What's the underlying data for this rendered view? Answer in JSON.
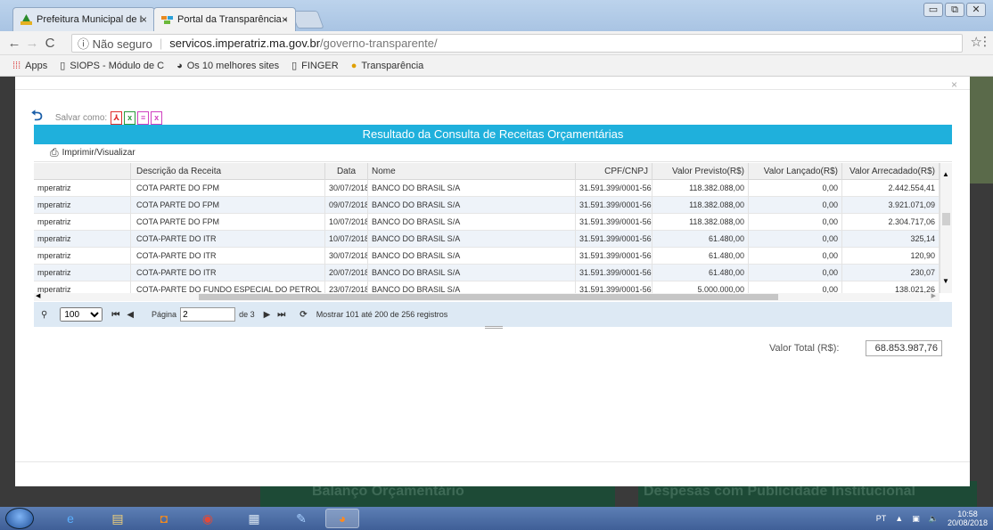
{
  "browser": {
    "tabs": [
      {
        "title": "Prefeitura Municipal de I",
        "close": "×"
      },
      {
        "title": "Portal da Transparência - ",
        "close": "×"
      }
    ],
    "window_controls": {
      "minimize": "▭",
      "restore": "⧉",
      "close": "✕"
    },
    "nav": {
      "back": "←",
      "forward": "→",
      "reload": "C"
    },
    "address": {
      "security": "ⓘ Não seguro",
      "host": "servicos.imperatriz.ma.gov.br",
      "path": "/governo-transparente/"
    },
    "star": "☆",
    "menu": "⋮",
    "bookmarks": [
      {
        "label": "Apps",
        "icon": "apps-grid-icon"
      },
      {
        "label": "SIOPS - Módulo de C",
        "icon": "page-icon"
      },
      {
        "label": "Os 10 melhores sites",
        "icon": "globe-icon"
      },
      {
        "label": "FINGER",
        "icon": "page-icon"
      },
      {
        "label": "Transparência",
        "icon": "info-icon"
      }
    ]
  },
  "background": {
    "text_left": "Balanço Orçamentário",
    "text_right": "Despesas com Publicidade Institucional"
  },
  "modal": {
    "close": "×",
    "save_as_label": "Salvar como:",
    "export_icons": [
      "pdf-icon",
      "excel-icon",
      "text-icon",
      "xlsx-icon"
    ],
    "grid_title": "Resultado da Consulta de Receitas Orçamentárias",
    "print_label": "Imprimir/Visualizar",
    "columns": [
      "Descrição da Receita",
      "Data",
      "Nome",
      "CPF/CNPJ",
      "Valor Previsto(R$)",
      "Valor Lançado(R$)",
      "Valor Arrecadado(R$)"
    ],
    "rows": [
      {
        "org": "mperatriz",
        "desc": "COTA PARTE DO FPM",
        "data": "30/07/2018",
        "nome": "BANCO DO BRASIL S/A",
        "cnpj": "31.591.399/0001-56",
        "previsto": "118.382.088,00",
        "lancado": "0,00",
        "arrecadado": "2.442.554,41"
      },
      {
        "org": "mperatriz",
        "desc": "COTA PARTE DO FPM",
        "data": "09/07/2018",
        "nome": "BANCO DO BRASIL S/A",
        "cnpj": "31.591.399/0001-56",
        "previsto": "118.382.088,00",
        "lancado": "0,00",
        "arrecadado": "3.921.071,09"
      },
      {
        "org": "mperatriz",
        "desc": "COTA PARTE DO FPM",
        "data": "10/07/2018",
        "nome": "BANCO DO BRASIL S/A",
        "cnpj": "31.591.399/0001-56",
        "previsto": "118.382.088,00",
        "lancado": "0,00",
        "arrecadado": "2.304.717,06"
      },
      {
        "org": "mperatriz",
        "desc": "COTA-PARTE DO ITR",
        "data": "10/07/2018",
        "nome": "BANCO DO BRASIL S/A",
        "cnpj": "31.591.399/0001-56",
        "previsto": "61.480,00",
        "lancado": "0,00",
        "arrecadado": "325,14"
      },
      {
        "org": "mperatriz",
        "desc": "COTA-PARTE DO ITR",
        "data": "30/07/2018",
        "nome": "BANCO DO BRASIL S/A",
        "cnpj": "31.591.399/0001-56",
        "previsto": "61.480,00",
        "lancado": "0,00",
        "arrecadado": "120,90"
      },
      {
        "org": "mperatriz",
        "desc": "COTA-PARTE DO ITR",
        "data": "20/07/2018",
        "nome": "BANCO DO BRASIL S/A",
        "cnpj": "31.591.399/0001-56",
        "previsto": "61.480,00",
        "lancado": "0,00",
        "arrecadado": "230,07"
      },
      {
        "org": "mperatriz",
        "desc": "COTA-PARTE DO FUNDO ESPECIAL DO PETROL",
        "data": "23/07/2018",
        "nome": "BANCO DO BRASIL S/A",
        "cnpj": "31.591.399/0001-56",
        "previsto": "5.000.000,00",
        "lancado": "0,00",
        "arrecadado": "138.021,26"
      }
    ],
    "pager": {
      "page_size": "100",
      "page_label": "Página",
      "page_value": "2",
      "of_label": "de 3",
      "status": "Mostrar 101 até 200 de 256 registros"
    },
    "total_label": "Valor Total (R$):",
    "total_value": "68.853.987,76"
  },
  "taskbar": {
    "apps": [
      "ie-icon",
      "explorer-icon",
      "outlook-icon",
      "chrome-icon",
      "calculator-icon",
      "paint-icon",
      "firefox-icon"
    ],
    "lang": "PT",
    "time": "10:58",
    "date": "20/08/2018"
  }
}
